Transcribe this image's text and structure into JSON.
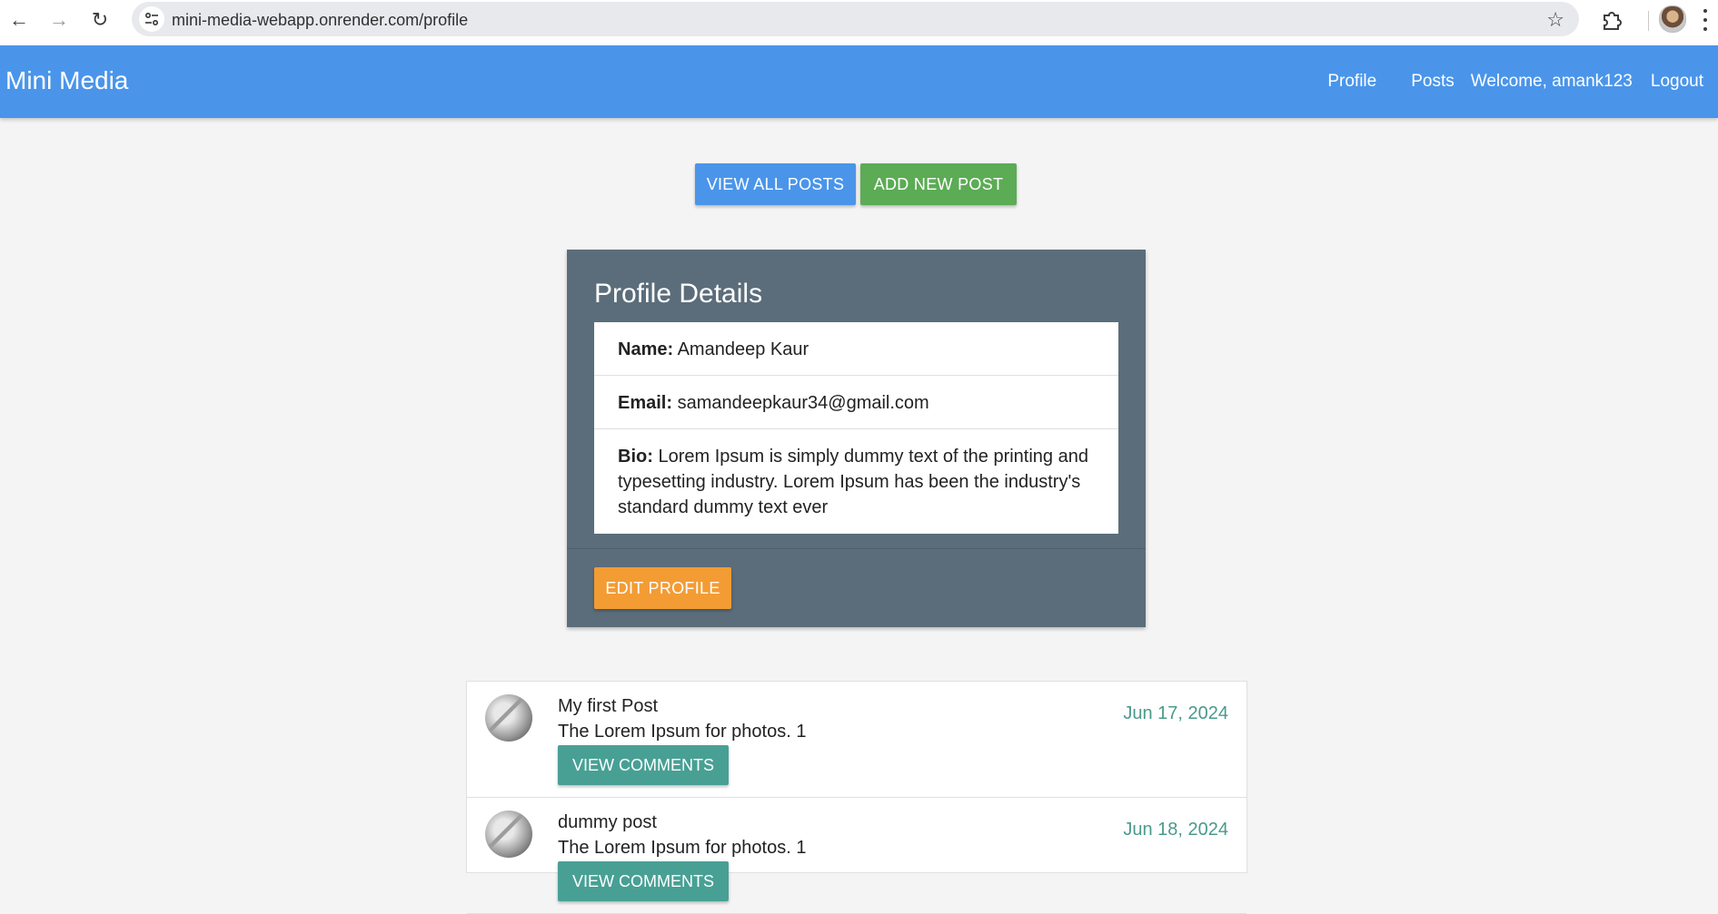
{
  "browser": {
    "url": "mini-media-webapp.onrender.com/profile"
  },
  "navbar": {
    "brand": "Mini Media",
    "links": {
      "profile": "Profile",
      "posts": "Posts",
      "welcome": "Welcome, amank123",
      "logout": "Logout"
    }
  },
  "actions": {
    "view_all_posts": "VIEW ALL POSTS",
    "add_new_post": "ADD NEW POST"
  },
  "profile": {
    "title": "Profile Details",
    "name_label": "Name:",
    "name": "Amandeep Kaur",
    "email_label": "Email:",
    "email": "samandeepkaur34@gmail.com",
    "bio_label": "Bio:",
    "bio": "Lorem Ipsum is simply dummy text of the printing and typesetting industry. Lorem Ipsum has been the industry's standard dummy text ever",
    "edit_button": "EDIT PROFILE"
  },
  "posts": [
    {
      "title": "My first Post",
      "body": "The Lorem Ipsum for photos. 1",
      "date": "Jun 17, 2024",
      "comments_button": "VIEW COMMENTS"
    },
    {
      "title": "dummy post",
      "body": "The Lorem Ipsum for photos. 1",
      "date": "Jun 18, 2024",
      "comments_button": "VIEW COMMENTS"
    }
  ],
  "colors": {
    "navbar": "#4a95ea",
    "view_button": "#4a95ea",
    "add_button": "#5cab55",
    "card": "#5b6d7a",
    "edit_button": "#f39c34",
    "comments_button": "#48a095",
    "date_text": "#4a9a8c"
  }
}
